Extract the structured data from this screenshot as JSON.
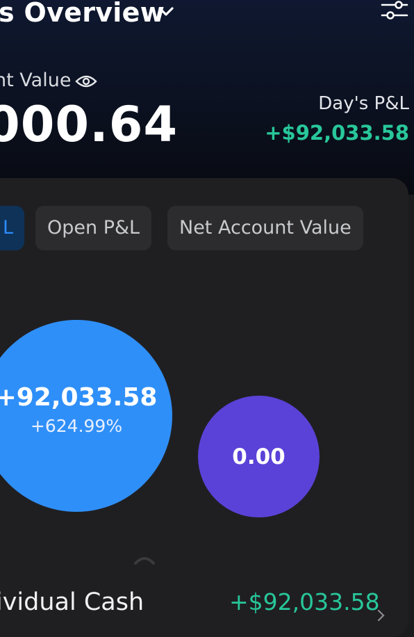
{
  "header": {
    "title": "s Overview",
    "title_icon": "chevron-down-icon",
    "settings_icon": "filter-sliders-icon",
    "net_value_label": "nt Value",
    "net_value_icon": "eye-icon",
    "net_value": "000.64",
    "days_pl_label": "Day's P&L",
    "days_pl_value": "+$92,033.58"
  },
  "tabs": [
    {
      "label": "L",
      "active": true
    },
    {
      "label": "Open P&L",
      "active": false
    },
    {
      "label": "Net Account Value",
      "active": false
    }
  ],
  "bubbles": [
    {
      "value": "+92,033.58",
      "percent": "+624.99%",
      "color": "#2f8ff8"
    },
    {
      "value": "0.00",
      "color": "#5a42d8"
    }
  ],
  "account": {
    "name": "ividual Cash",
    "value": "+$92,033.58"
  },
  "colors": {
    "positive": "#28c79a",
    "accent": "#2d8cff",
    "background": "#1b1b1d"
  }
}
